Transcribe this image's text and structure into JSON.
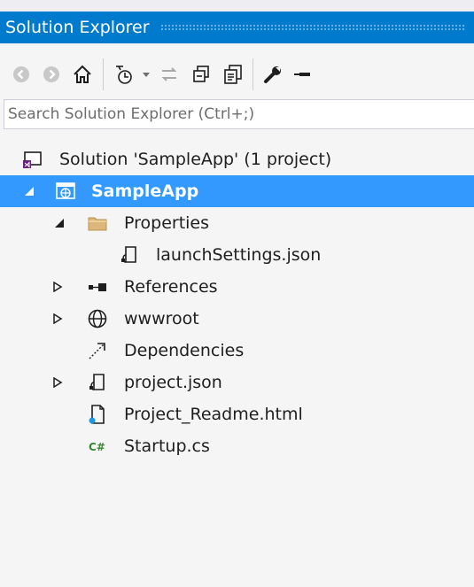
{
  "panel": {
    "title": "Solution Explorer"
  },
  "toolbar": {
    "icons": [
      "back-icon",
      "forward-icon",
      "home-icon",
      "pending-changes-filter-icon",
      "dropdown-arrow-icon",
      "sync-with-active-document-icon",
      "collapse-all-icon",
      "show-all-files-icon",
      "properties-icon",
      "preview-selected-items-icon"
    ]
  },
  "search": {
    "placeholder": "Search Solution Explorer (Ctrl+;)"
  },
  "tree": {
    "solution": "Solution 'SampleApp' (1 project)",
    "project": "SampleApp",
    "properties": "Properties",
    "launch_settings": "launchSettings.json",
    "references": "References",
    "wwwroot": "wwwroot",
    "dependencies": "Dependencies",
    "project_json": "project.json",
    "readme": "Project_Readme.html",
    "startup": "Startup.cs"
  },
  "colors": {
    "title_bar": "#007acc",
    "selection": "#3399ff",
    "background": "#f5f5f5"
  }
}
